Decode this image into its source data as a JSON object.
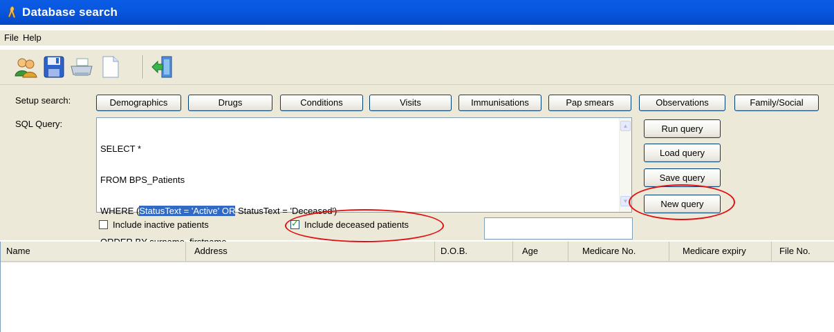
{
  "window": {
    "title": "Database search"
  },
  "menu": [
    "File",
    "Help"
  ],
  "toolbar": {
    "icons": [
      "users-icon",
      "save-icon",
      "print-icon",
      "new-document-icon",
      "exit-icon"
    ]
  },
  "setup": {
    "label": "Setup search:",
    "buttons": [
      "Demographics",
      "Drugs",
      "Conditions",
      "Visits",
      "Immunisations",
      "Pap smears",
      "Observations",
      "Family/Social"
    ]
  },
  "sql": {
    "label": "SQL Query:",
    "line1": "SELECT *",
    "line2": "FROM BPS_Patients",
    "line3_pre": "WHERE (",
    "line3_sel": "StatusText = 'Active' OR",
    "line3_post": " StatusText = 'Deceased')",
    "line4": "ORDER BY surname, firstname"
  },
  "actions": {
    "run": "Run query",
    "load": "Load query",
    "save": "Save query",
    "new": "New query"
  },
  "options": {
    "inactive_label": "Include inactive patients",
    "inactive_checked": false,
    "deceased_label": "Include deceased patients",
    "deceased_checked": true
  },
  "status_field_value": "",
  "results": {
    "columns": [
      "Name",
      "Address",
      "D.O.B.",
      "Age",
      "Medicare No.",
      "Medicare expiry",
      "File No."
    ],
    "rows": []
  },
  "colors": {
    "title_bar": "#0a5ae4",
    "window_face": "#ece9d8",
    "selection": "#316ac5",
    "annotation_ring": "#e01010"
  }
}
